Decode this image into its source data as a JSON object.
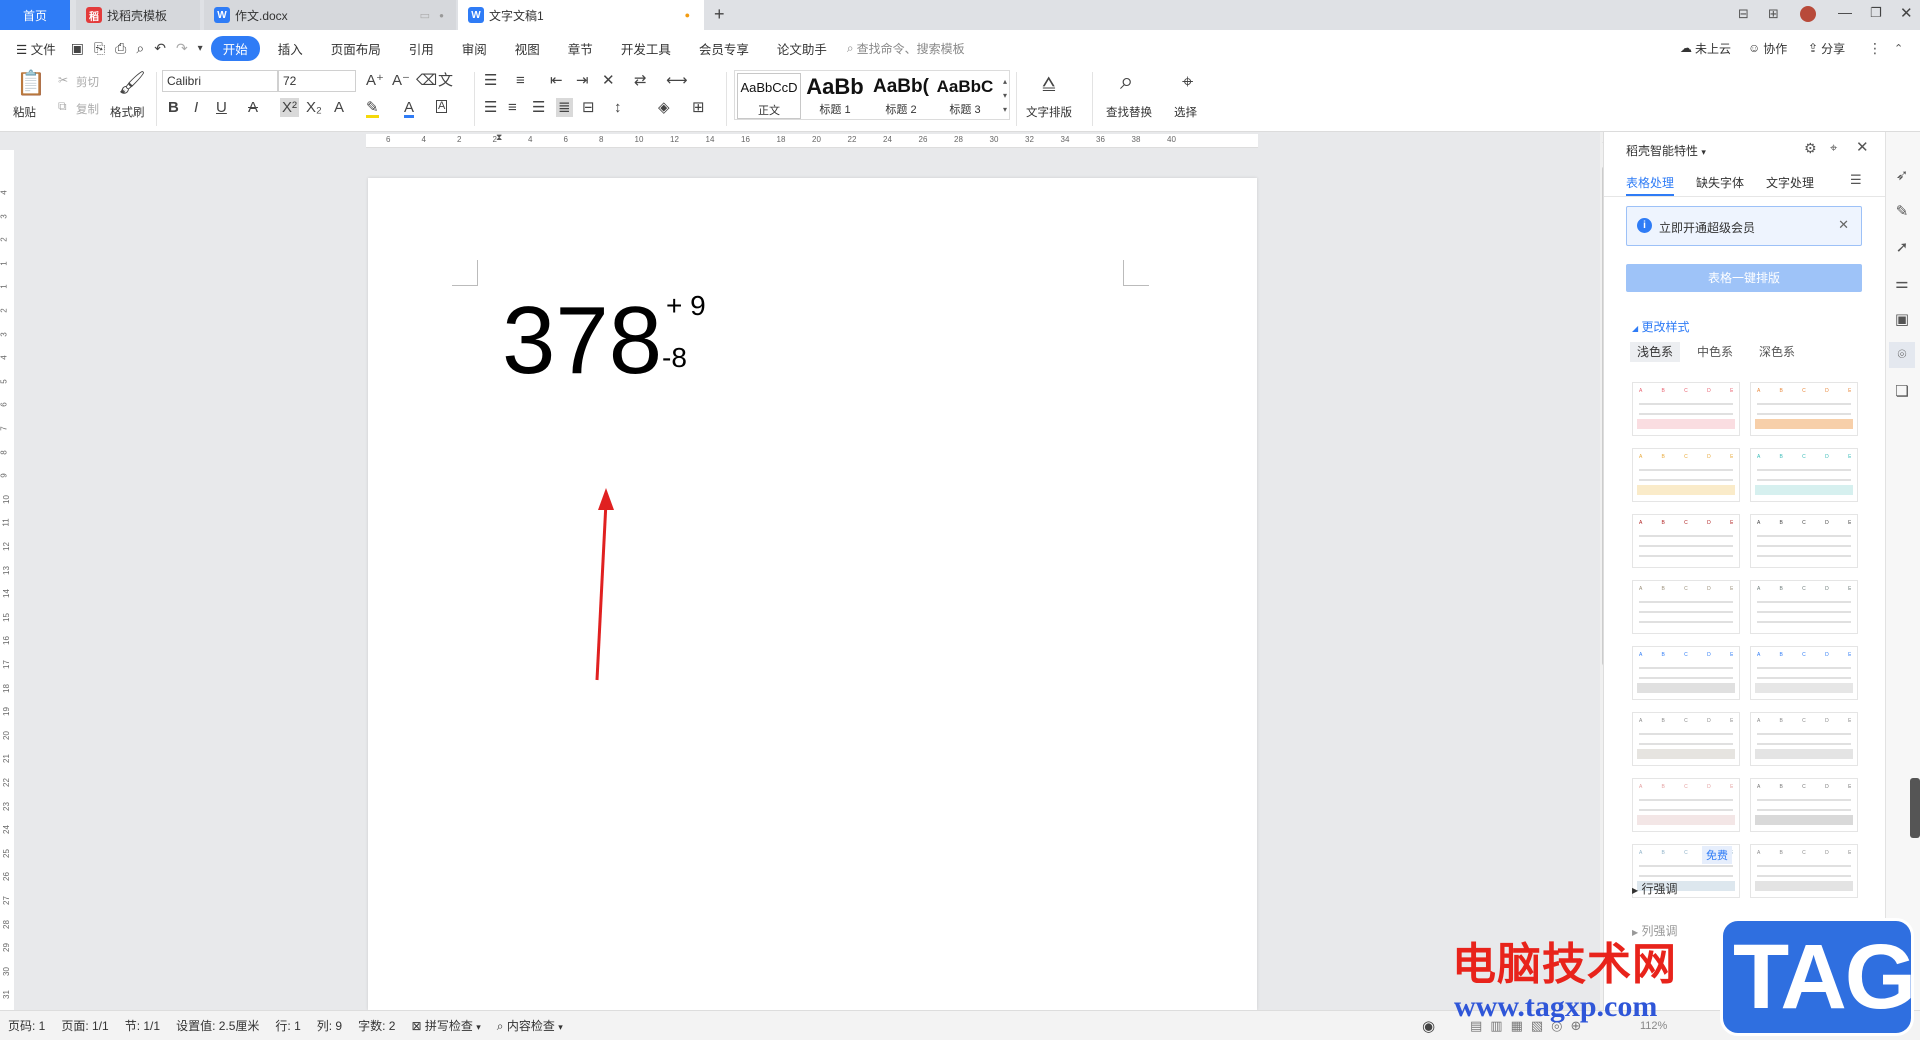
{
  "tabs": [
    {
      "label": "首页"
    },
    {
      "label": "找稻壳模板"
    },
    {
      "label": "作文.docx"
    },
    {
      "label": "文字文稿1"
    }
  ],
  "menu": {
    "file_label": "文件",
    "items": [
      "开始",
      "插入",
      "页面布局",
      "引用",
      "审阅",
      "视图",
      "章节",
      "开发工具",
      "会员专享",
      "论文助手"
    ],
    "search_placeholder": "查找命令、搜索模板",
    "right": [
      "未上云",
      "协作",
      "分享"
    ]
  },
  "ribbon": {
    "paste": "粘贴",
    "cut": "剪切",
    "copy": "复制",
    "format_painter": "格式刷",
    "font_name": "Calibri",
    "font_size": "72",
    "styles": [
      {
        "preview": "AaBbCcD",
        "name": "正文"
      },
      {
        "preview": "AaBb",
        "name": "标题 1"
      },
      {
        "preview": "AaBb(",
        "name": "标题 2"
      },
      {
        "preview": "AaBbC",
        "name": "标题 3"
      }
    ],
    "text_layout": "文字排版",
    "find_replace": "查找替换",
    "select": "选择"
  },
  "ruler": {
    "h_ticks": [
      "6",
      "4",
      "2",
      "2",
      "4",
      "6",
      "8",
      "10",
      "12",
      "14",
      "16",
      "18",
      "20",
      "22",
      "24",
      "26",
      "28",
      "30",
      "32",
      "34",
      "36",
      "38",
      "40"
    ],
    "v_ticks": [
      "4",
      "3",
      "2",
      "1",
      "1",
      "2",
      "3",
      "4",
      "5",
      "6",
      "7",
      "8",
      "9",
      "10",
      "11",
      "12",
      "13",
      "14",
      "15",
      "16",
      "17",
      "18",
      "19",
      "20",
      "21",
      "22",
      "23",
      "24",
      "25",
      "26",
      "27",
      "28",
      "29",
      "30",
      "31"
    ]
  },
  "document": {
    "main_number": "378",
    "superscript": "+ 9",
    "subscript": "-8"
  },
  "panel": {
    "title": "稻壳智能特性",
    "tabs": [
      "表格处理",
      "缺失字体",
      "文字处理"
    ],
    "notice": "立即开通超级会员",
    "primary_button": "表格一键排版",
    "section_change_style": "更改样式",
    "color_tabs": [
      "浅色系",
      "中色系",
      "深色系"
    ],
    "thumb_header": "A B C D E",
    "free_badge": "免费",
    "section_row": "行强调",
    "section_col": "列强调"
  },
  "status": {
    "page_num": "页码: 1",
    "pages": "页面: 1/1",
    "section": "节: 1/1",
    "setting": "设置值: 2.5厘米",
    "row": "行: 1",
    "col": "列: 9",
    "words": "字数: 2",
    "spell": "拼写检查",
    "content_check": "内容检查",
    "zoom": "112%"
  },
  "watermark": {
    "text_cn": "电脑技术网",
    "url": "www.tagxp.com",
    "tag": "TAG"
  },
  "colors": {
    "accent": "#2f7cf6",
    "arrow": "#e02020",
    "watermark_red": "#e8231b"
  }
}
